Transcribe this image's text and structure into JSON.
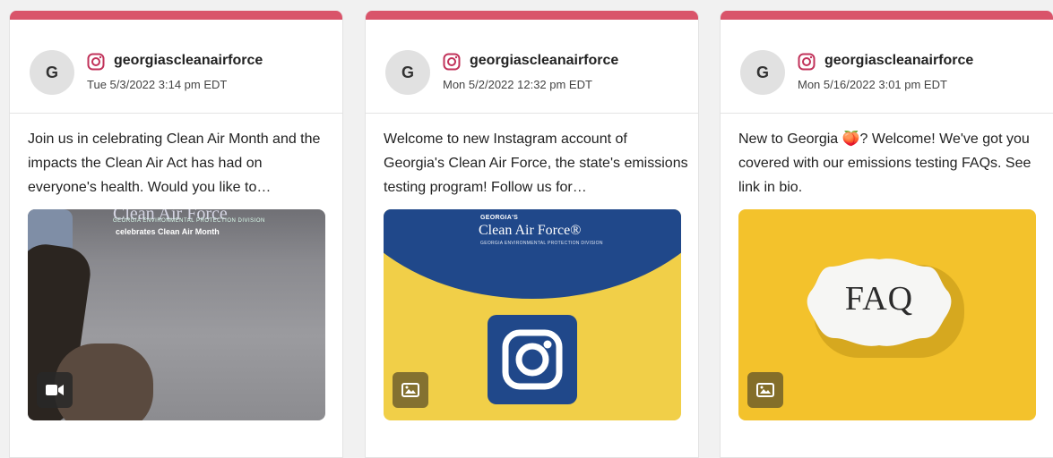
{
  "posts": [
    {
      "avatar_initial": "G",
      "username": "georgiascleanairforce",
      "timestamp": "Tue 5/3/2022 3:14 pm EDT",
      "text": "Join us in celebrating Clean Air Month and the impacts the Clean Air Act has had on everyone's health. Would you like to…",
      "media": {
        "type_icon": "video-icon",
        "caption_title": "Clean Air Force",
        "caption_sub": "GEORGIA ENVIRONMENTAL PROTECTION DIVISION",
        "caption_text": "celebrates Clean Air Month"
      }
    },
    {
      "avatar_initial": "G",
      "username": "georgiascleanairforce",
      "timestamp": "Mon 5/2/2022 12:32 pm EDT",
      "text": "Welcome to new Instagram account of Georgia's Clean Air Force, the state's emissions testing program! Follow us for…",
      "media": {
        "type_icon": "image-icon",
        "brand_top": "GEORGIA'S",
        "brand_main": "Clean Air Force®",
        "brand_sub": "GEORGIA ENVIRONMENTAL PROTECTION DIVISION"
      }
    },
    {
      "avatar_initial": "G",
      "username": "georgiascleanairforce",
      "timestamp": "Mon 5/16/2022 3:01 pm EDT",
      "text": "New to Georgia 🍑? Welcome! We've got you covered with our emissions testing FAQs.  See link in bio.",
      "media": {
        "type_icon": "image-icon",
        "faq_text": "FAQ"
      }
    }
  ],
  "colors": {
    "accent_bar": "#d9546a",
    "instagram": "#c1325a",
    "navy": "#20488a",
    "yellow": "#f1cf48"
  }
}
